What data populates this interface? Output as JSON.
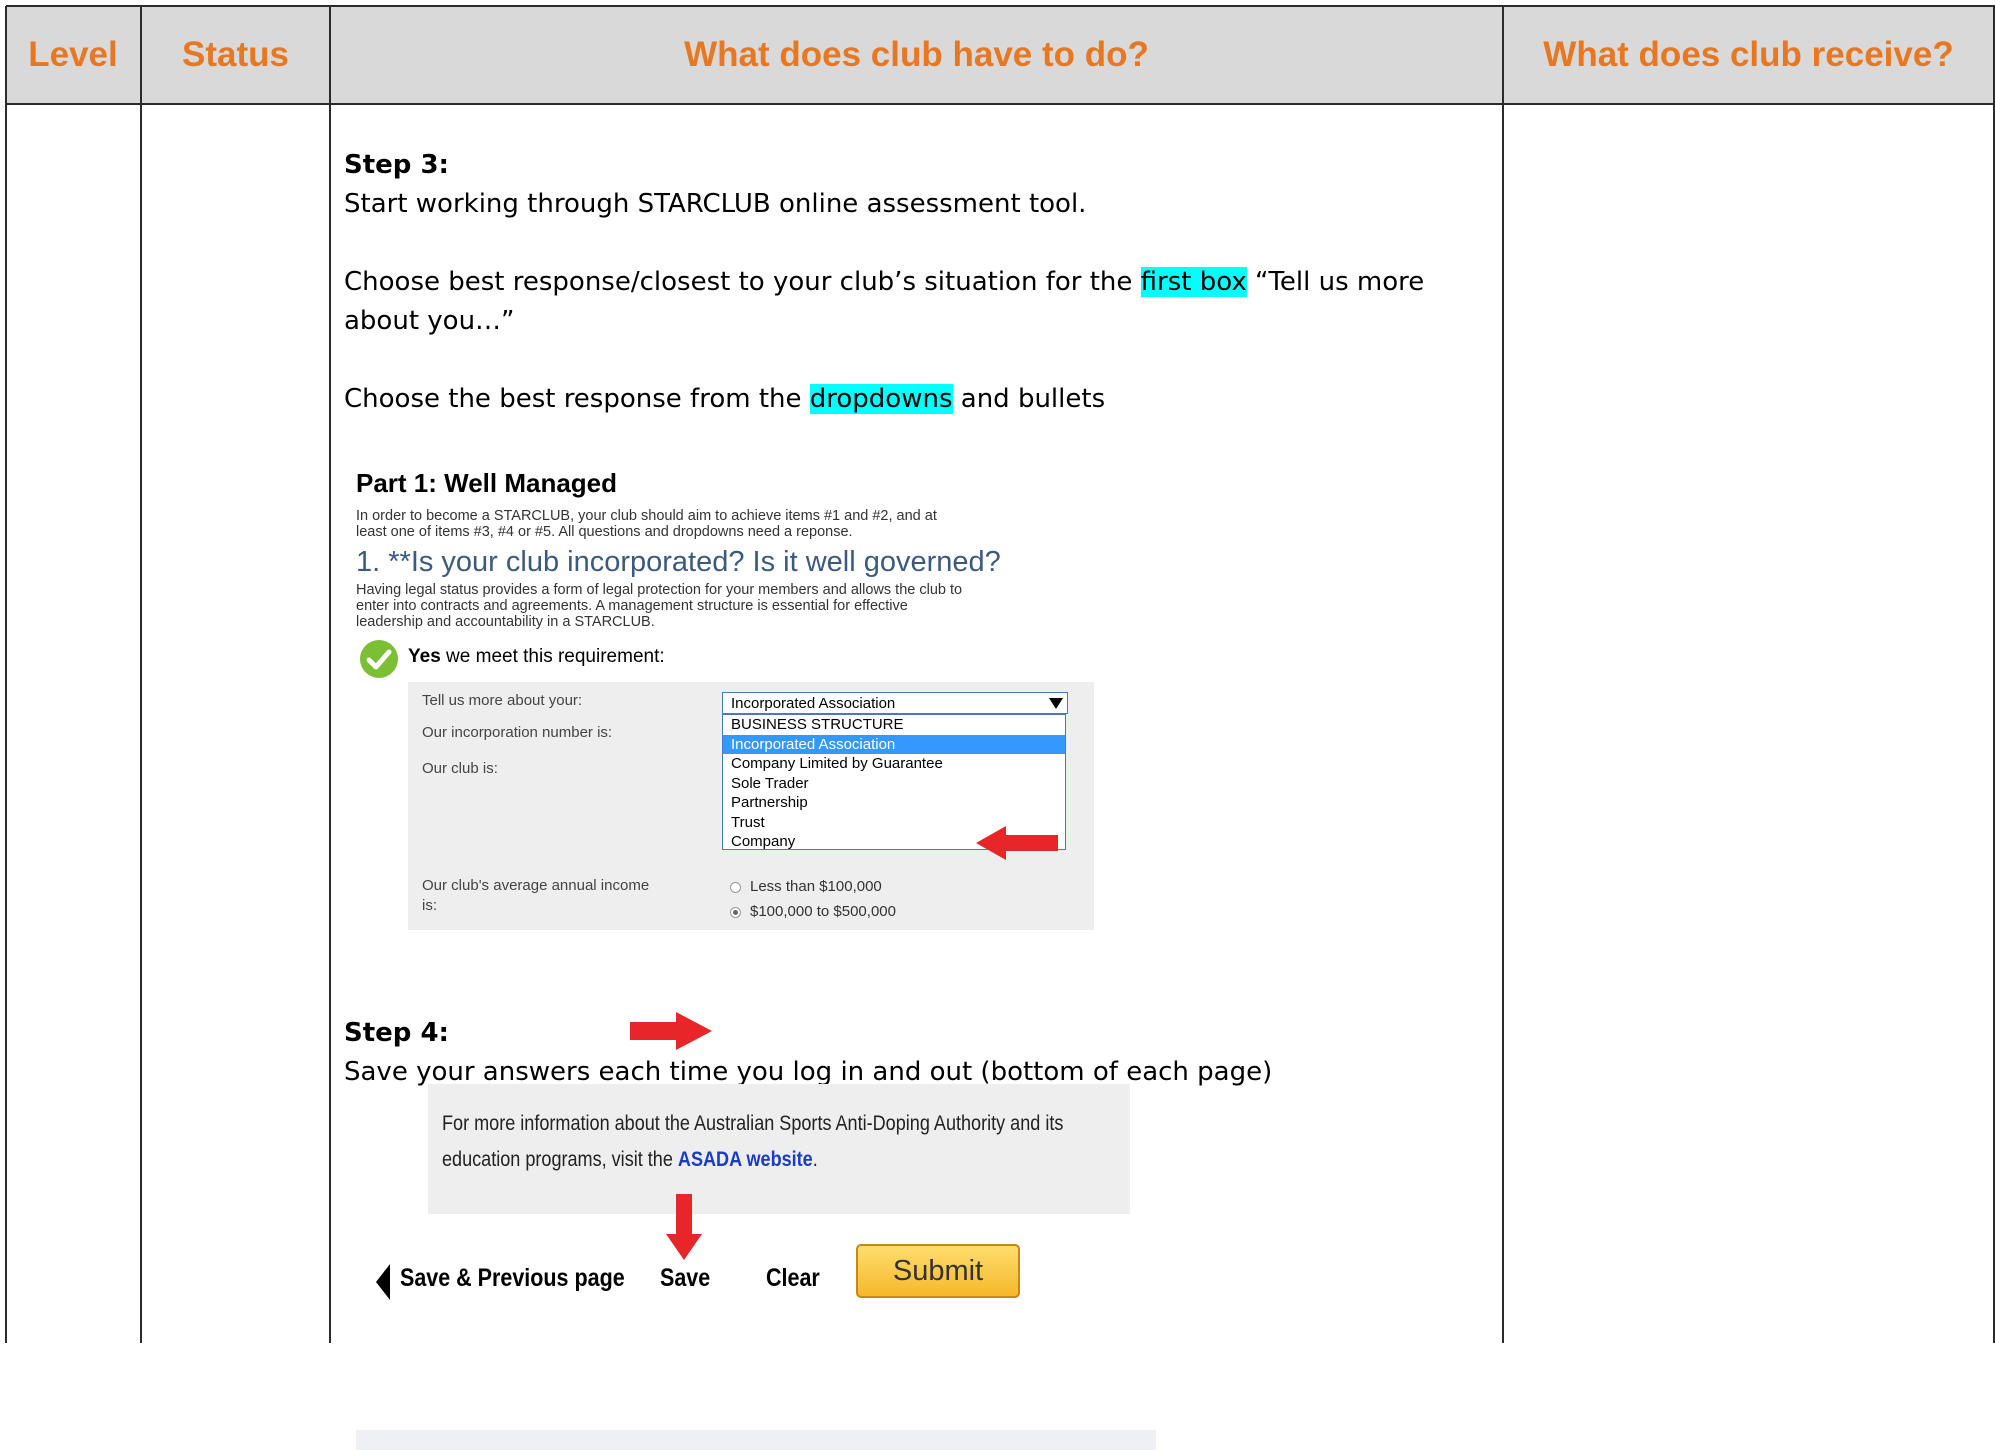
{
  "header": {
    "level": "Level",
    "status": "Status",
    "todo": "What does club have to do?",
    "receive": "What does club receive?"
  },
  "step3": {
    "heading": "Step 3:",
    "line1": "Start working through STARCLUB online assessment tool.",
    "line2_pre": "Choose best response/closest to your club’s situation for the ",
    "line2_hl": "first box",
    "line2_post": " “Tell us more",
    "line3": "about you…”",
    "line4_pre": "Choose the best response from the ",
    "line4_hl": "dropdowns",
    "line4_post": " and bullets"
  },
  "form": {
    "title": "Part 1: Well Managed",
    "intro_1": "In order to become a STARCLUB, your club should aim to achieve items #1 and #2, and at",
    "intro_2": "least one of items #3, #4 or #5. All questions and dropdowns need a reponse.",
    "question": "1. **Is your club incorporated? Is it well governed?",
    "desc_1": "Having legal status provides a form of legal protection for your members and allows the club to",
    "desc_2": "enter into contracts and agreements. A management structure is essential for effective",
    "desc_3": "leadership and accountability in a STARCLUB.",
    "yes_bold": "Yes",
    "yes_rest": " we meet this requirement:",
    "label_tell": "Tell us more about your:",
    "label_incorp": "Our incorporation number is:",
    "label_club": "Our club is:",
    "label_income_1": "Our club's average annual income",
    "label_income_2": "is:",
    "select_value": "Incorporated Association",
    "options": [
      "BUSINESS STRUCTURE",
      "Incorporated Association",
      "Company Limited by Guarantee",
      "Sole Trader",
      "Partnership",
      "Trust",
      "Company"
    ],
    "radio_1": "Less than $100,000",
    "radio_2": "$100,000 to $500,000"
  },
  "step4": {
    "heading": "Step 4:",
    "line1": "Save your answers each time you log in and out (bottom of each page)"
  },
  "savebar": {
    "info_1": "For more information about the Australian Sports Anti-Doping Authority and its",
    "info_2_pre": "education programs, visit the ",
    "info_link": "ASADA website",
    "info_2_post": ".",
    "prev": "Save & Previous page",
    "save": "Save",
    "clear": "Clear",
    "submit": "Submit"
  }
}
